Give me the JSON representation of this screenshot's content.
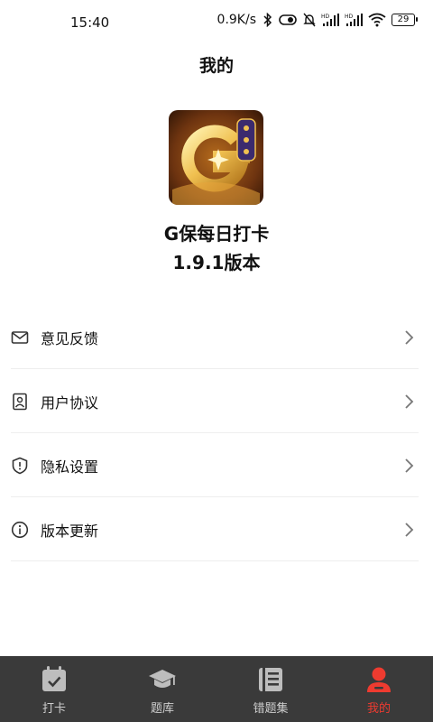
{
  "status_bar": {
    "time": "15:40",
    "network_speed": "0.9K/s",
    "battery_level": "29"
  },
  "page": {
    "title": "我的"
  },
  "app_info": {
    "name": "G保每日打卡",
    "version": "1.9.1版本"
  },
  "menu": {
    "items": [
      {
        "label": "意见反馈",
        "icon": "mail-icon"
      },
      {
        "label": "用户协议",
        "icon": "user-agreement-icon"
      },
      {
        "label": "隐私设置",
        "icon": "shield-icon"
      },
      {
        "label": "版本更新",
        "icon": "info-icon"
      }
    ]
  },
  "tabbar": {
    "tabs": [
      {
        "label": "打卡",
        "icon": "calendar-check-icon",
        "active": false
      },
      {
        "label": "题库",
        "icon": "graduation-cap-icon",
        "active": false
      },
      {
        "label": "错题集",
        "icon": "list-book-icon",
        "active": false
      },
      {
        "label": "我的",
        "icon": "person-icon",
        "active": true
      }
    ]
  },
  "colors": {
    "accent": "#ee3b30",
    "tabbar_bg": "#3a3a3a",
    "divider": "#eeeeee"
  }
}
